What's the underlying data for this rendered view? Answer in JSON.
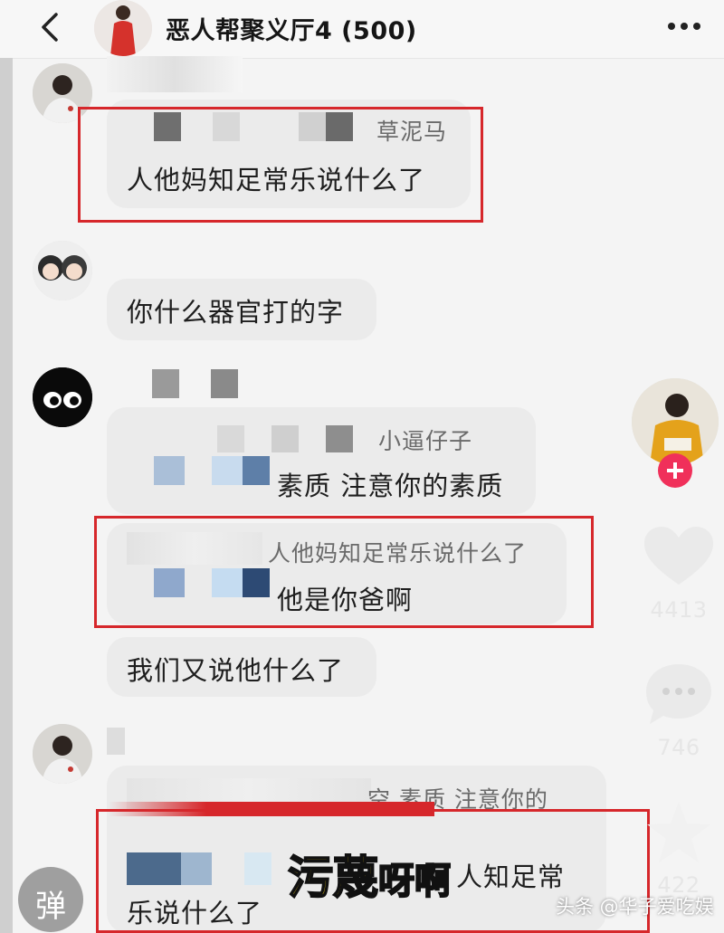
{
  "header": {
    "title": "恶人帮聚义厅4 (500)"
  },
  "messages": [
    {
      "quote_name": "草泥马",
      "text": "人他妈知足常乐说什么了"
    },
    {
      "text": "你什么器官打的字"
    },
    {
      "quote_name": "小逼仔子",
      "quote_text_line2": "素质 注意你的素质",
      "reply_quote": "人他妈知足常乐说什么了",
      "reply_text": "他是你爸啊"
    },
    {
      "text": "我们又说他什么了"
    },
    {
      "quote_text": "空 素质 注意你的",
      "line1": "人知足常",
      "line2": "乐说什么了"
    }
  ],
  "side": {
    "likes": "4413",
    "comments": "746",
    "favorites": "422",
    "danmaku_label": "弹"
  },
  "overlay": {
    "subtitle_part1": "污蔑",
    "subtitle_part2": "呀啊"
  },
  "watermark": "头条 @华子爱吃娱"
}
